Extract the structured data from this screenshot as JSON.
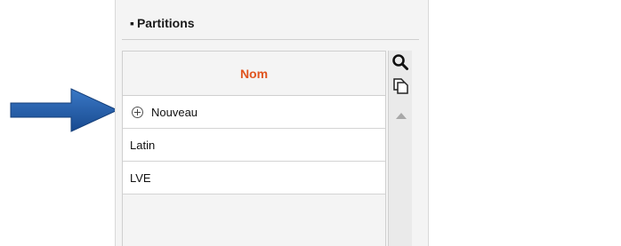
{
  "section": {
    "title": "Partitions"
  },
  "grid": {
    "header": "Nom",
    "new_label": "Nouveau",
    "rows": [
      "Latin",
      "LVE"
    ]
  },
  "colors": {
    "header_text": "#e0541f",
    "arrow": "#1e5aa8"
  },
  "icons": [
    "search-icon",
    "copy-icon",
    "plus-circle-icon",
    "scroll-up-icon",
    "pointer-arrow"
  ]
}
